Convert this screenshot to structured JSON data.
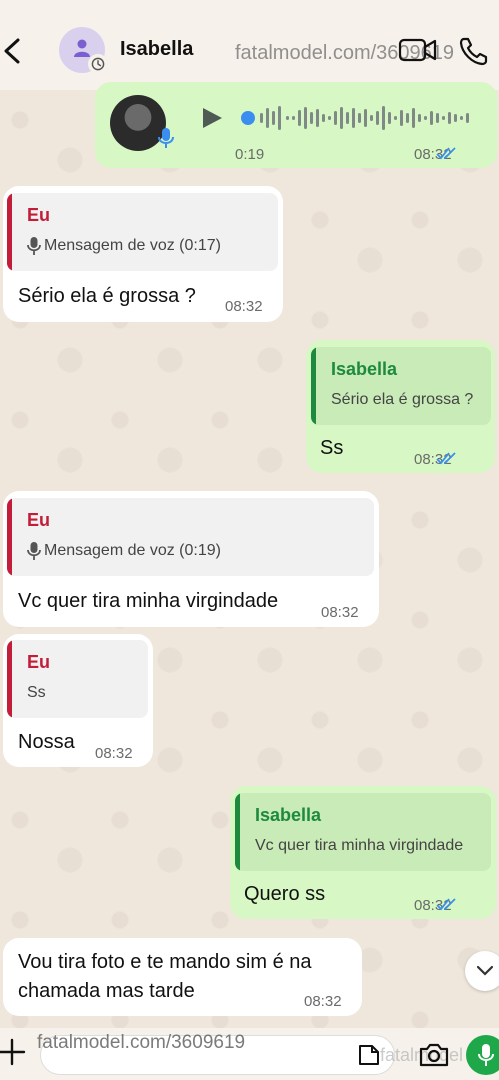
{
  "header": {
    "contact_name": "Isabella",
    "watermark": "fatalmodel.com/3609619"
  },
  "messages": [
    {
      "type": "voice",
      "direction": "out",
      "duration": "0:19",
      "time": "08:32",
      "status": "read"
    },
    {
      "type": "reply",
      "direction": "in",
      "quote_author": "Eu",
      "quote_text": "Mensagem de voz (0:17)",
      "text": "Sério ela é grossa ?",
      "time": "08:32"
    },
    {
      "type": "reply",
      "direction": "out",
      "quote_author": "Isabella",
      "quote_text": "Sério ela é grossa ?",
      "text": "Ss",
      "time": "08:32",
      "status": "read"
    },
    {
      "type": "reply",
      "direction": "in",
      "quote_author": "Eu",
      "quote_text": "Mensagem de voz (0:19)",
      "text": "Vc quer tira minha virgindade",
      "time": "08:32"
    },
    {
      "type": "reply",
      "direction": "in",
      "quote_author": "Eu",
      "quote_text": "Ss",
      "text": "Nossa",
      "time": "08:32"
    },
    {
      "type": "reply",
      "direction": "out",
      "quote_author": "Isabella",
      "quote_text": "Vc quer tira minha virgindade",
      "text": "Quero ss",
      "time": "08:32",
      "status": "read"
    },
    {
      "type": "text",
      "direction": "in",
      "line1": "Vou tira foto e te mando sim é na",
      "line2": "chamada mas tarde",
      "time": "08:32"
    }
  ],
  "input": {
    "watermark": "fatalmodel.com/3609619",
    "watermark2": "fatalmodel"
  },
  "colors": {
    "in_quote_author": "#c21e3a",
    "out_quote_author": "#1e8a3e",
    "read_ticks": "#3a8ef0",
    "mic_button": "#1ea84a"
  }
}
